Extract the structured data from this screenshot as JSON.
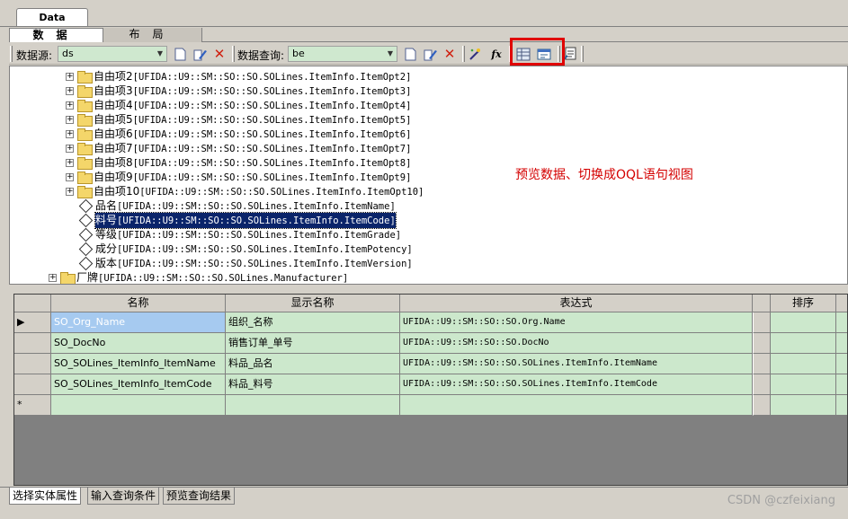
{
  "top_tab": "Data",
  "inner_tabs": [
    "数据",
    "布局"
  ],
  "toolbar": {
    "datasource_label": "数据源:",
    "datasource_value": "ds",
    "query_label": "数据查询:",
    "query_value": "be"
  },
  "annotation": "预览数据、切换成OQL语句视图",
  "tree": [
    {
      "type": "folder",
      "name": "自由项2",
      "code": "[UFIDA::U9::SM::SO::SO.SOLines.ItemInfo.ItemOpt2]"
    },
    {
      "type": "folder",
      "name": "自由项3",
      "code": "[UFIDA::U9::SM::SO::SO.SOLines.ItemInfo.ItemOpt3]"
    },
    {
      "type": "folder",
      "name": "自由项4",
      "code": "[UFIDA::U9::SM::SO::SO.SOLines.ItemInfo.ItemOpt4]"
    },
    {
      "type": "folder",
      "name": "自由项5",
      "code": "[UFIDA::U9::SM::SO::SO.SOLines.ItemInfo.ItemOpt5]"
    },
    {
      "type": "folder",
      "name": "自由项6",
      "code": "[UFIDA::U9::SM::SO::SO.SOLines.ItemInfo.ItemOpt6]"
    },
    {
      "type": "folder",
      "name": "自由项7",
      "code": "[UFIDA::U9::SM::SO::SO.SOLines.ItemInfo.ItemOpt7]"
    },
    {
      "type": "folder",
      "name": "自由项8",
      "code": "[UFIDA::U9::SM::SO::SO.SOLines.ItemInfo.ItemOpt8]"
    },
    {
      "type": "folder",
      "name": "自由项9",
      "code": "[UFIDA::U9::SM::SO::SO.SOLines.ItemInfo.ItemOpt9]"
    },
    {
      "type": "folder",
      "name": "自由项10",
      "code": "[UFIDA::U9::SM::SO::SO.SOLines.ItemInfo.ItemOpt10]"
    },
    {
      "type": "field",
      "name": "品名",
      "code": "[UFIDA::U9::SM::SO::SO.SOLines.ItemInfo.ItemName]"
    },
    {
      "type": "field",
      "name": "料号",
      "code": "[UFIDA::U9::SM::SO::SO.SOLines.ItemInfo.ItemCode]",
      "selected": true
    },
    {
      "type": "field",
      "name": "等级",
      "code": "[UFIDA::U9::SM::SO::SO.SOLines.ItemInfo.ItemGrade]"
    },
    {
      "type": "field",
      "name": "成分",
      "code": "[UFIDA::U9::SM::SO::SO.SOLines.ItemInfo.ItemPotency]"
    },
    {
      "type": "field",
      "name": "版本",
      "code": "[UFIDA::U9::SM::SO::SO.SOLines.ItemInfo.ItemVersion]"
    },
    {
      "type": "folder",
      "name": "厂牌",
      "code": "[UFIDA::U9::SM::SO::SO.SOLines.Manufacturer]"
    }
  ],
  "grid": {
    "headers": [
      "名称",
      "显示名称",
      "表达式",
      "排序"
    ],
    "rows": [
      {
        "name": "SO_Org_Name",
        "display": "组织_名称",
        "expr": "UFIDA::U9::SM::SO::SO.Org.Name"
      },
      {
        "name": "SO_DocNo",
        "display": "销售订单_单号",
        "expr": "UFIDA::U9::SM::SO::SO.DocNo"
      },
      {
        "name": "SO_SOLines_ItemInfo_ItemName",
        "display": "料品_品名",
        "expr": "UFIDA::U9::SM::SO::SO.SOLines.ItemInfo.ItemName"
      },
      {
        "name": "SO_SOLines_ItemInfo_ItemCode",
        "display": "料品_料号",
        "expr": "UFIDA::U9::SM::SO::SO.SOLines.ItemInfo.ItemCode"
      }
    ],
    "new_row_marker": "*"
  },
  "bottom_tabs": [
    "选择实体属性",
    "输入查询条件",
    "预览查询结果"
  ],
  "watermark": "CSDN @czfeixiang"
}
